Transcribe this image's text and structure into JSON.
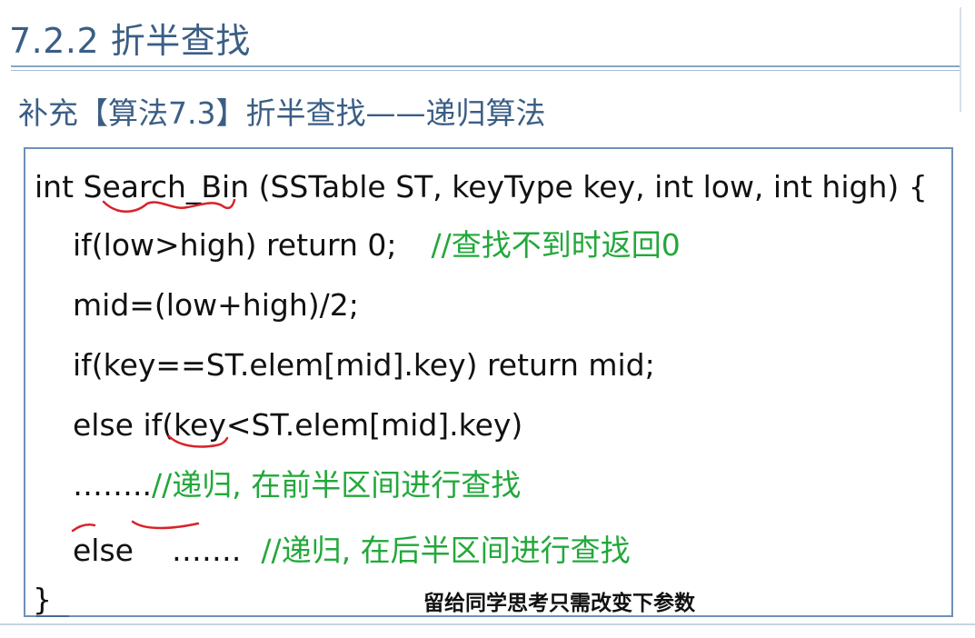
{
  "slide": {
    "title": "7.2.2 折半查找",
    "subtitle": "补充【算法7.3】折半查找——递归算法"
  },
  "code": {
    "line1": "int Search_Bin (SSTable ST, keyType key, int low, int high) {",
    "line2_code": "if(low>high) return 0;",
    "line2_comment": "//查找不到时返回0",
    "line3": "mid=(low+high)/2;",
    "line4": "if(key==ST.elem[mid].key)  return mid;",
    "line5": "else if(key<ST.elem[mid].key)",
    "line6_code": "……..",
    "line6_comment": "//递归, 在前半区间进行查找",
    "line7_code": "else    …….",
    "line7_comment": "//递归, 在后半区间进行查找",
    "line8": "}"
  },
  "note": "留给同学思考只需改变下参数",
  "colors": {
    "heading": "#3b5e85",
    "comment": "#22a83a",
    "annotation_ink": "#d8232a",
    "box_border": "#6f8fb8"
  }
}
